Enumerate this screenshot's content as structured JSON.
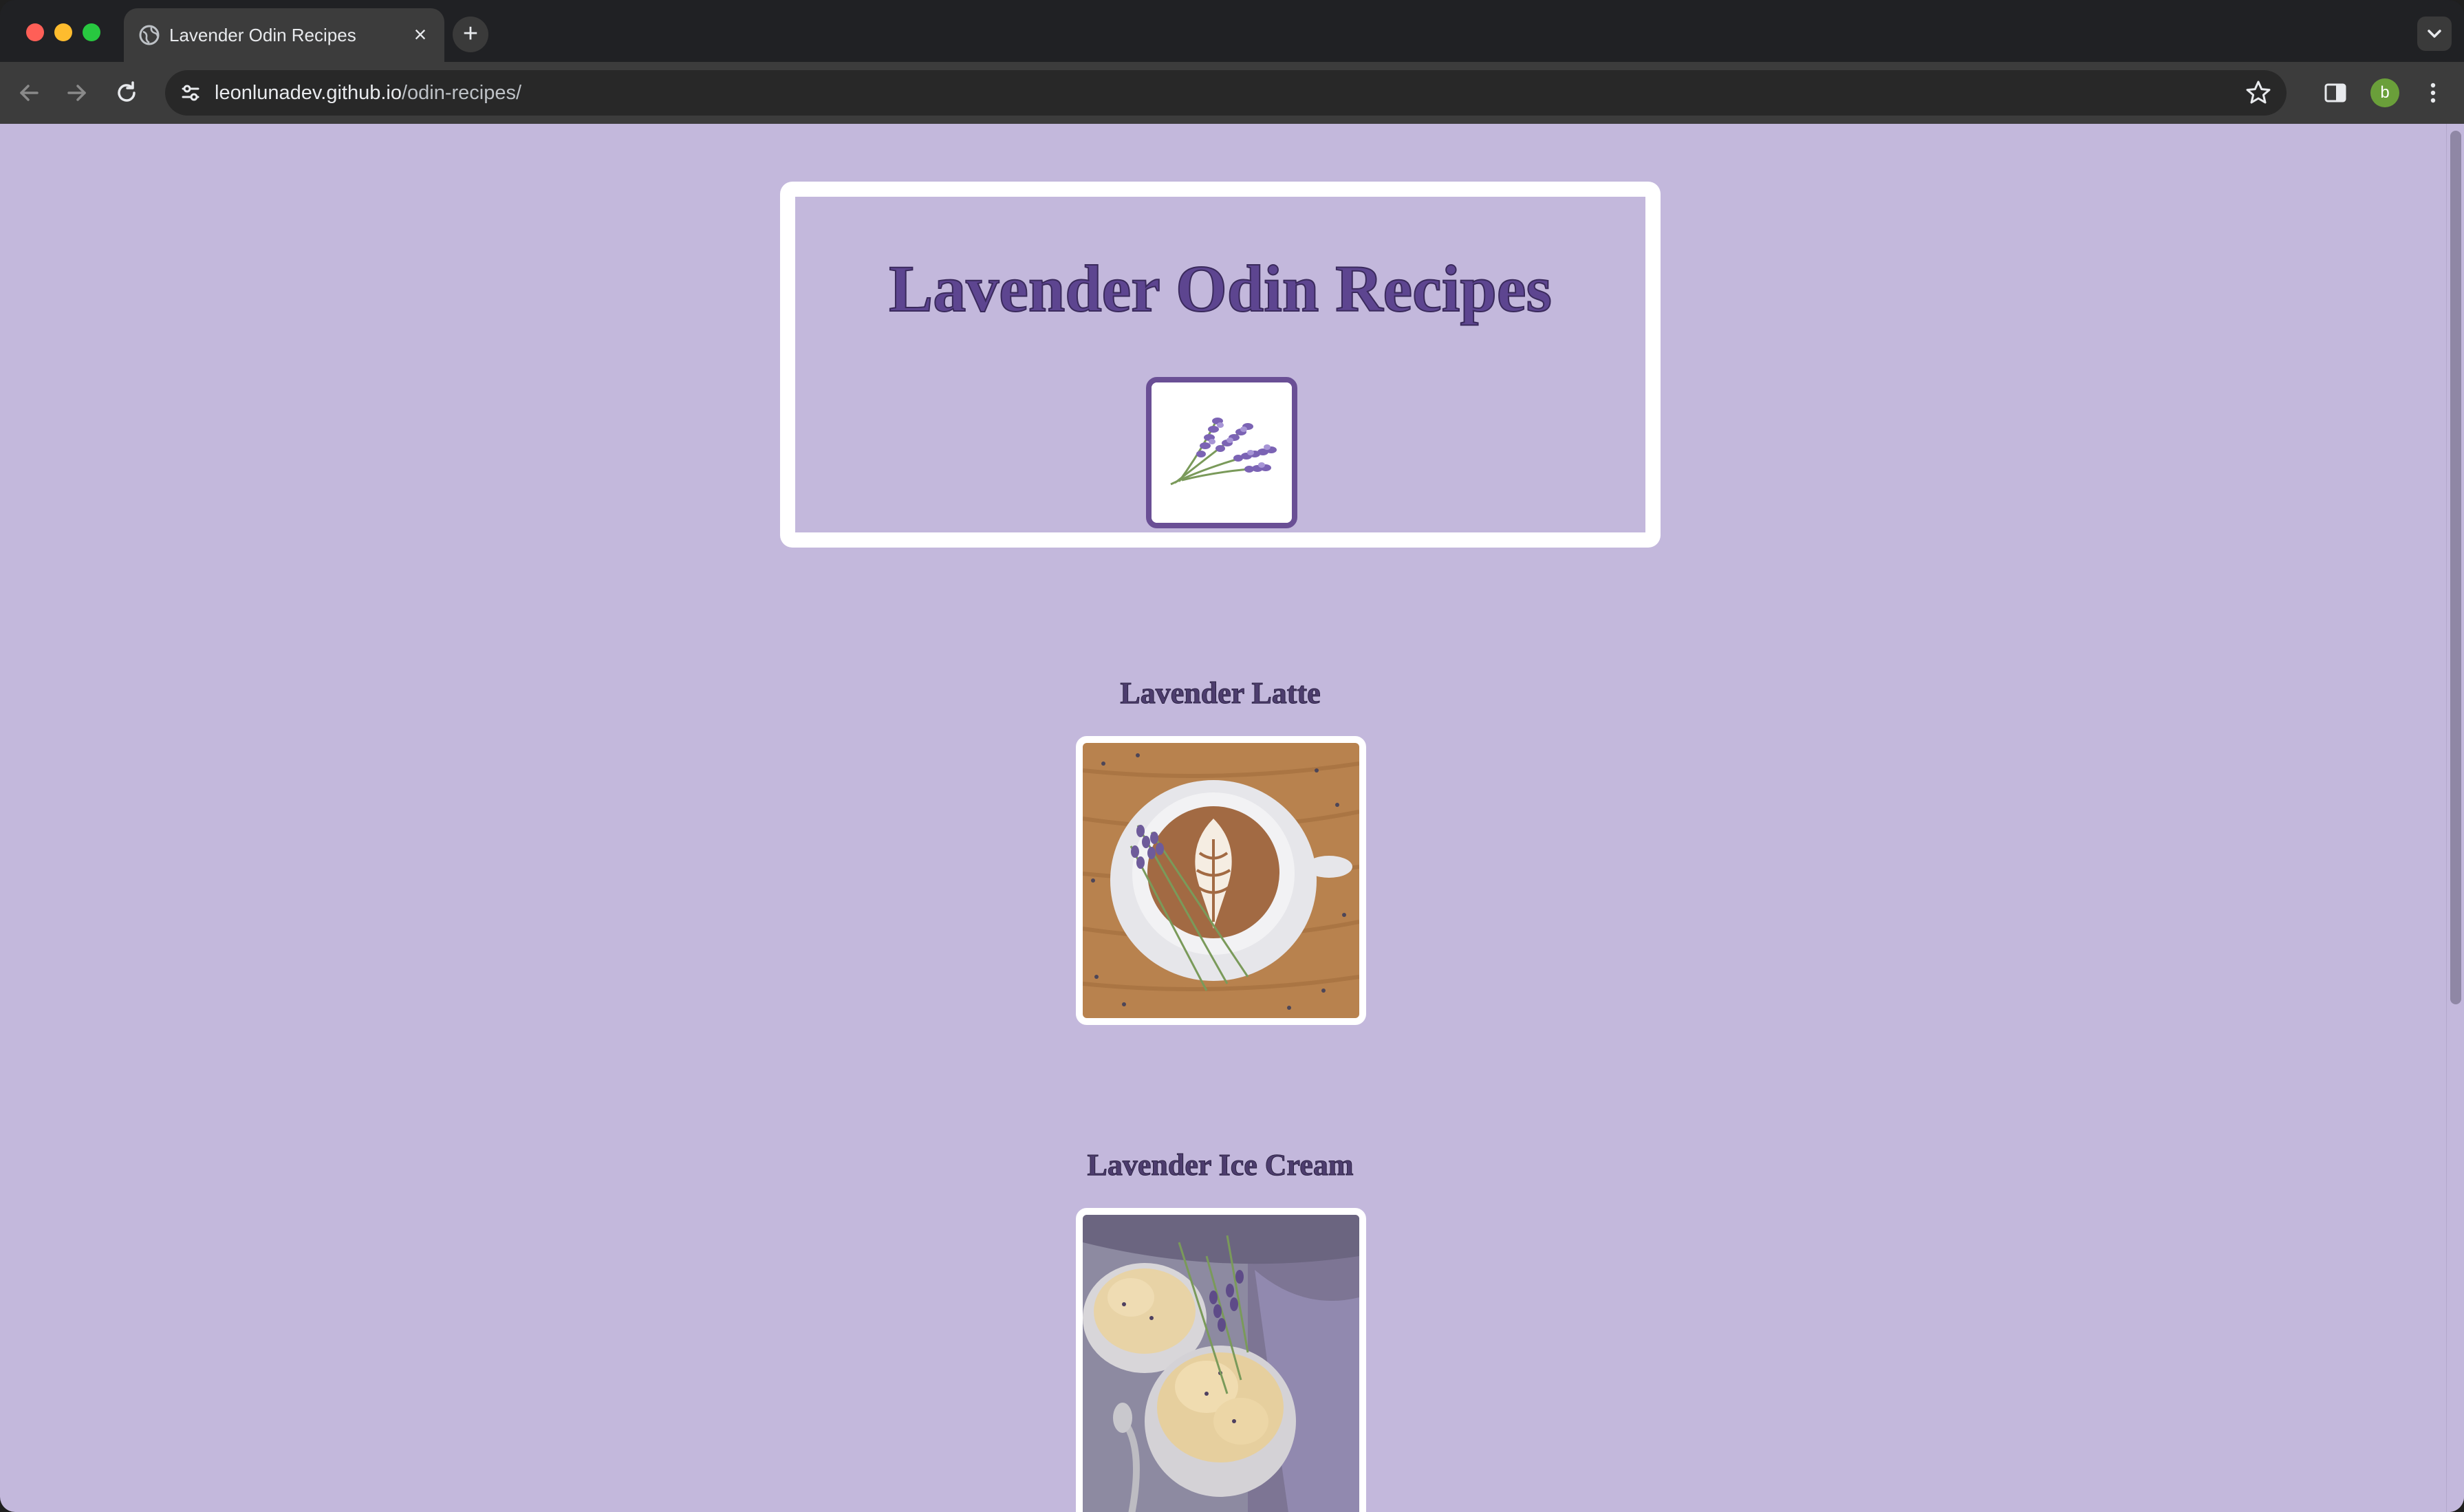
{
  "browser": {
    "tab": {
      "title": "Lavender Odin Recipes",
      "favicon": "globe-icon",
      "close_glyph": "×"
    },
    "new_tab_glyph": "+",
    "url": {
      "host": "leonlunadev.github.io",
      "path": "/odin-recipes/"
    },
    "profile_initial": "b"
  },
  "colors": {
    "page_background": "#c3b8dc",
    "title_text": "#5d4590",
    "frame_border": "#ffffff",
    "logo_border": "#6a4f95",
    "avatar": "#6a9f3a"
  },
  "page": {
    "title": "Lavender Odin Recipes",
    "logo": "lavender-sprig-image",
    "recipes": [
      {
        "title": "Lavender Latte",
        "image": "lavender-latte-photo"
      },
      {
        "title": "Lavender Ice Cream",
        "image": "lavender-ice-cream-photo"
      }
    ]
  }
}
